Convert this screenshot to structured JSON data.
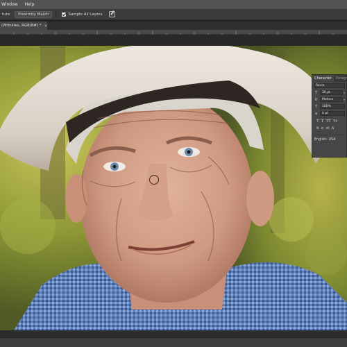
{
  "menu": {
    "window_label": "Window",
    "help_label": "Help"
  },
  "options": {
    "type_label": "ture",
    "proximity_match_label": "Proximity Match",
    "sample_all_layers_label": "Sample All Layers"
  },
  "document_tab": {
    "title": "(Wrinkles, RGB/8#) *",
    "close_glyph": "×"
  },
  "character_panel": {
    "tab_character": "Character",
    "tab_paragraph": "Paragr",
    "font_family": "Revie",
    "font_size": "36 pt",
    "kerning": "Metrics",
    "vertical_scale": "100%",
    "baseline_shift": "0 pt",
    "language": "English: USA",
    "style_buttons": [
      "T",
      "T",
      "TT",
      "Tr"
    ],
    "style_buttons_row2": [
      "fi",
      "σ",
      "st",
      "A"
    ]
  },
  "colors": {
    "panel_bg": "#464646",
    "menubar_bg": "#535353",
    "optbar_bg": "#3c3c3c"
  }
}
